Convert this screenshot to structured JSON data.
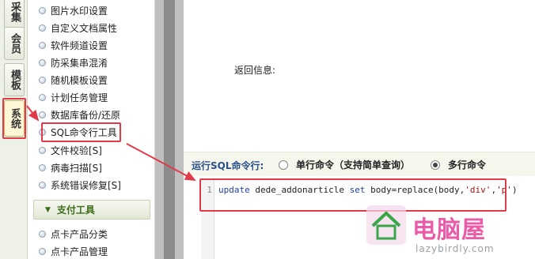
{
  "tabs": [
    "采集",
    "会员",
    "模板",
    "系统"
  ],
  "menu": {
    "items": [
      "图片水印设置",
      "自定义文档属性",
      "软件频道设置",
      "防采集串混淆",
      "随机模板设置",
      "计划任务管理",
      "数据库备份/还原",
      "SQL命令行工具",
      "文件校验[S]",
      "病毒扫描[S]",
      "系统错误修复[S]"
    ],
    "group_title": "支付工具",
    "group_items": [
      "点卡产品分类",
      "点卡产品管理"
    ]
  },
  "main": {
    "return_label": "返回信息:",
    "sql_label": "运行SQL命令行:",
    "option_single": "单行命令（支持简单查询）",
    "option_multi": "多行命令",
    "selected": "multi",
    "line_number": "1",
    "code": {
      "kw1": "update",
      "t1": " dede_addonarticle ",
      "kw2": "set",
      "t2": " body=replace(body,",
      "s1": "'div'",
      "t3": ",",
      "s2": "'p'",
      "t4": ")"
    }
  },
  "watermark": {
    "title": "电脑屋",
    "url": "lazybirdly.com"
  },
  "colors": {
    "highlight": "#e03b4a",
    "watermark": "#e8409a"
  }
}
